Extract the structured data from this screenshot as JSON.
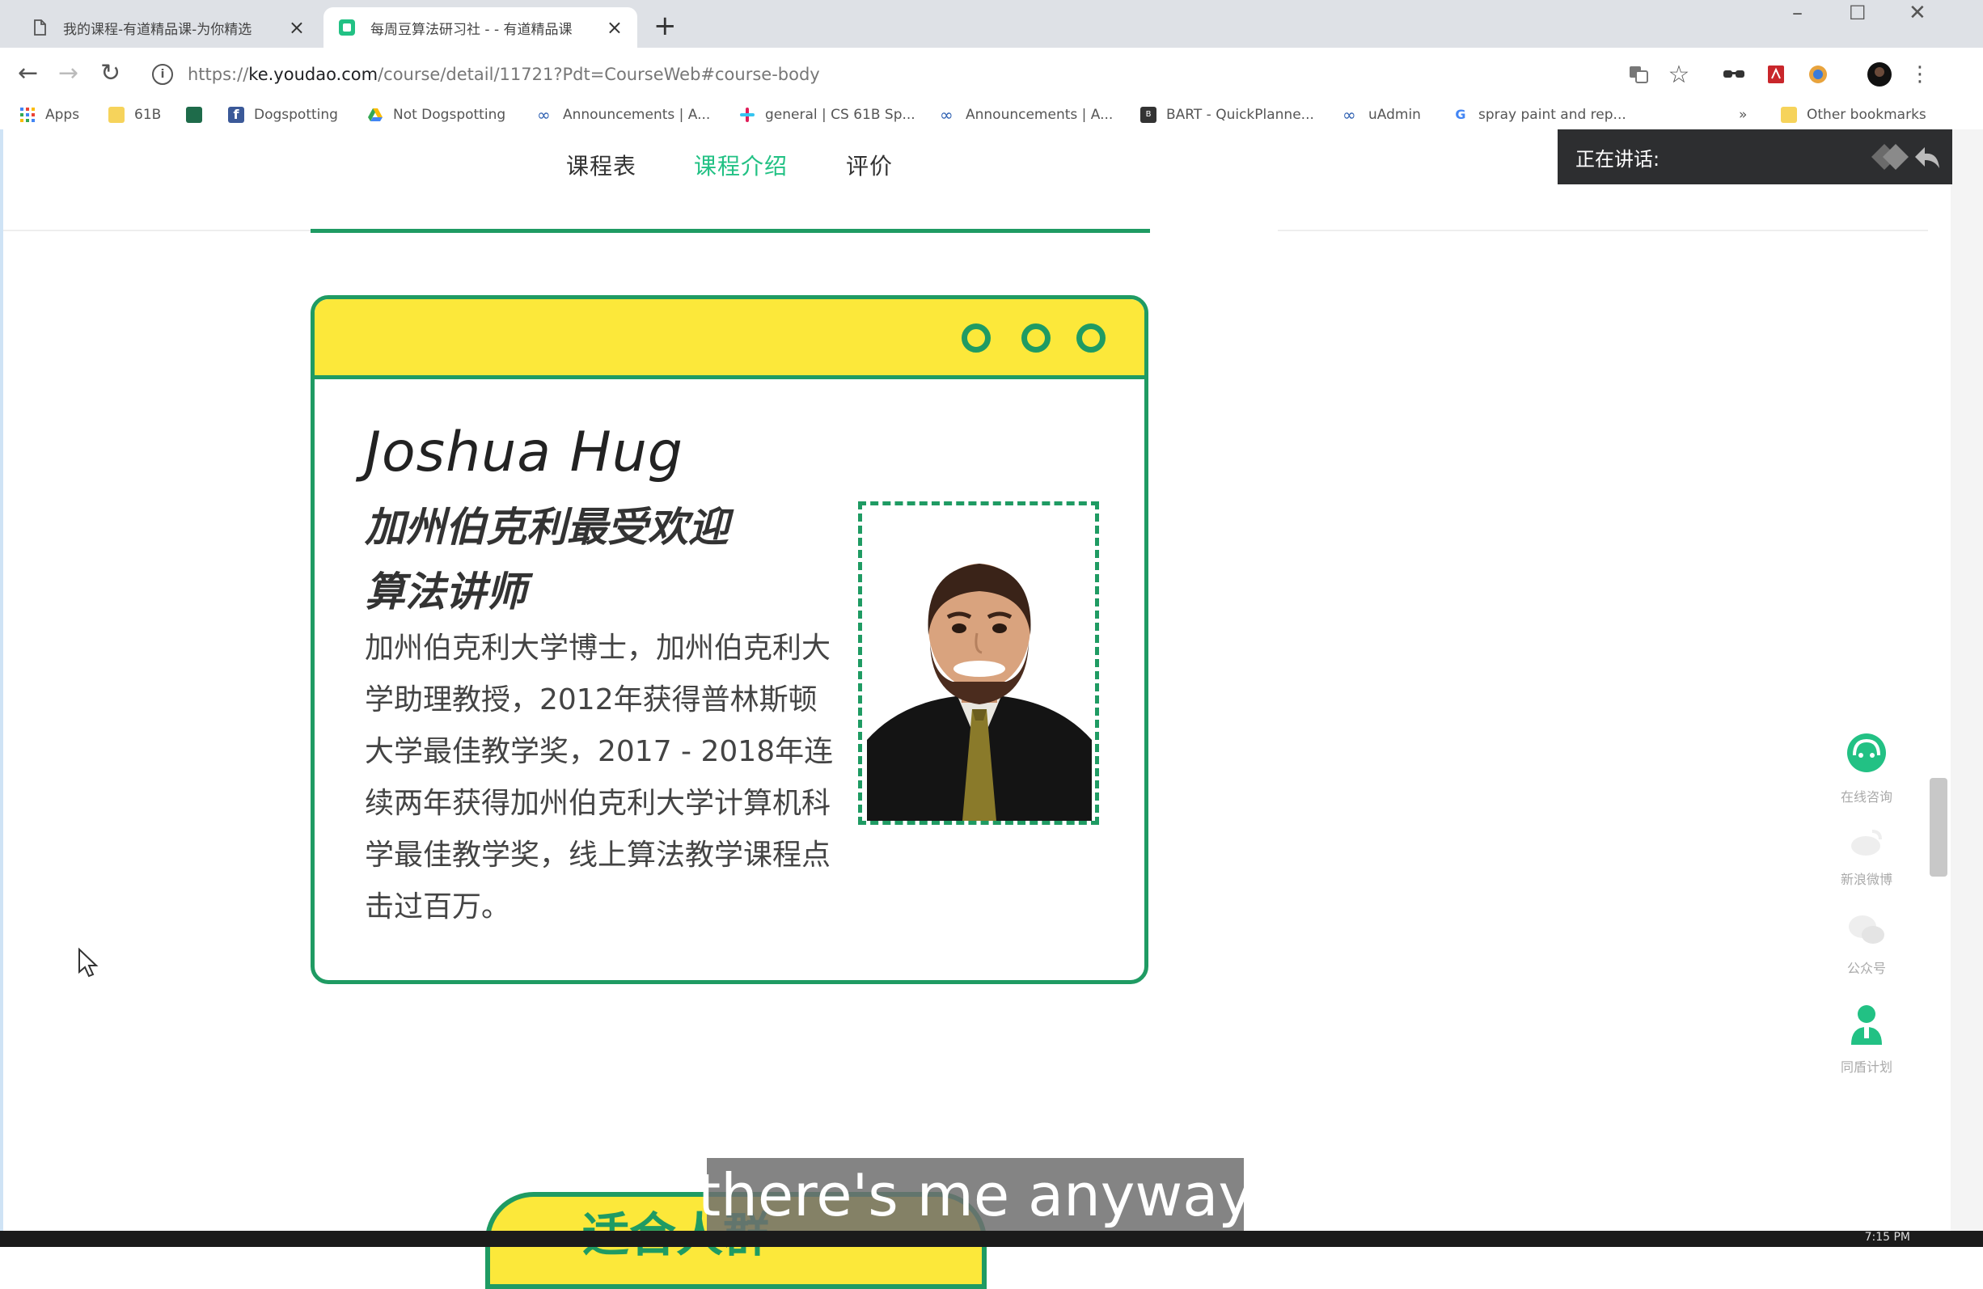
{
  "browser": {
    "tabs": [
      {
        "title": "我的课程-有道精品课-为你精选",
        "active": false
      },
      {
        "title": "每周豆算法研习社 - - 有道精品课",
        "active": true
      }
    ],
    "url_scheme": "https://",
    "url_host": "ke.youdao.com",
    "url_path": "/course/detail/11721?Pdt=CourseWeb#course-body",
    "bookmarks": [
      {
        "label": "Apps",
        "icon": "apps-grid-icon"
      },
      {
        "label": "61B",
        "icon": "folder-icon"
      },
      {
        "label": "",
        "icon": "photo-app-icon"
      },
      {
        "label": "Dogspotting",
        "icon": "facebook-icon"
      },
      {
        "label": "Not Dogspotting",
        "icon": "google-drive-icon"
      },
      {
        "label": "Announcements | A...",
        "icon": "infinity-icon"
      },
      {
        "label": "general | CS 61B Sp...",
        "icon": "slack-icon"
      },
      {
        "label": "Announcements | A...",
        "icon": "infinity-icon"
      },
      {
        "label": "BART - QuickPlanne...",
        "icon": "bart-icon"
      },
      {
        "label": "uAdmin",
        "icon": "infinity-icon"
      },
      {
        "label": "spray paint and rep...",
        "icon": "google-icon"
      }
    ],
    "other_bookmarks": "Other bookmarks",
    "more_bookmarks": "»"
  },
  "page": {
    "tabs": [
      {
        "label": "课程表",
        "active": false
      },
      {
        "label": "课程介绍",
        "active": true
      },
      {
        "label": "评价",
        "active": false
      }
    ],
    "teacher": {
      "name": "Joshua Hug",
      "title_line1": "加州伯克利最受欢迎",
      "title_line2": "算法讲师",
      "description": "加州伯克利大学博士，加州伯克利大学助理教授，2012年获得普林斯顿大学最佳教学奖，2017 - 2018年连续两年获得加州伯克利大学计算机科学最佳教学奖，线上算法教学课程点击过百万。"
    },
    "banner_text": "适合人群",
    "sidebar": [
      {
        "label": "在线咨询",
        "icon": "headset-icon"
      },
      {
        "label": "新浪微博",
        "icon": "weibo-icon"
      },
      {
        "label": "公众号",
        "icon": "wechat-icon"
      },
      {
        "label": "同盾计划",
        "icon": "person-icon"
      }
    ]
  },
  "overlay": {
    "speaking_label": "正在讲话:",
    "caption": "there's me anyway"
  },
  "taskbar": {
    "clock": "7:15 PM"
  },
  "colors": {
    "accent_green": "#22c184",
    "card_green": "#1f9b63",
    "card_yellow": "#fce83a"
  }
}
